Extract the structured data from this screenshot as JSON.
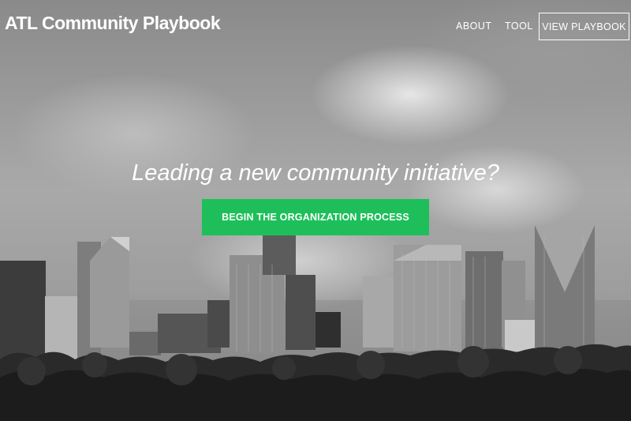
{
  "header": {
    "brand": "ATL Community Playbook",
    "nav": {
      "about": "ABOUT",
      "tool": "TOOL",
      "view_playbook": "VIEW PLAYBOOK"
    }
  },
  "hero": {
    "headline": "Leading a new community initiative?",
    "cta_label": "BEGIN THE ORGANIZATION PROCESS",
    "background_image": "black-and-white-city-skyline-photo"
  },
  "colors": {
    "cta_green": "#1ebf5a",
    "text_white": "#ffffff"
  }
}
